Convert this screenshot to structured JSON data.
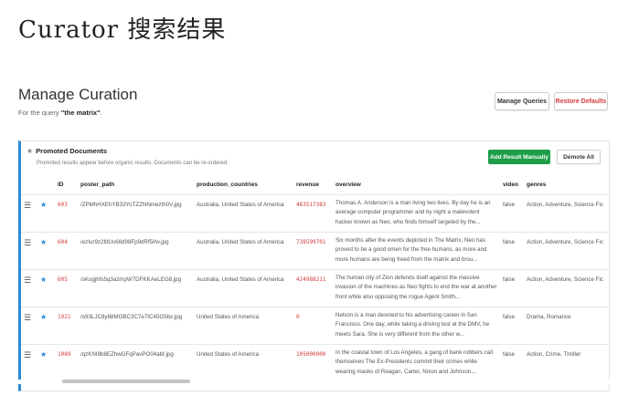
{
  "page_title": "Curator 搜索结果",
  "manage": {
    "title": "Manage Curation",
    "query_prefix": "For the query ",
    "query_text": "\"the matrix\"",
    "query_suffix": ".",
    "manage_queries_label": "Manage Queries",
    "restore_defaults_label": "Restore Defaults"
  },
  "promoted": {
    "title": "Promoted Documents",
    "subtitle": "Promoted results appear before organic results. Documents can be re-ordered.",
    "add_label": "Add Result Manually",
    "demote_label": "Demote All"
  },
  "table": {
    "columns": [
      "ID",
      "poster_path",
      "production_countries",
      "revenue",
      "overview",
      "video",
      "genres"
    ],
    "rows": [
      {
        "id": "603",
        "poster_path": "/ZPMhHXEhYB33YoTZZNNmezth0V.jpg",
        "production_countries": "Australia, United States of America",
        "revenue": "463517383",
        "overview": "Thomas A. Anderson is a man living two lives. By day he is an average computer programmer and by night a malevolent hacker known as Neo, who finds himself targeted by the...",
        "video": "false",
        "genres": "Action, Adventure, Science Fic"
      },
      {
        "id": "604",
        "poster_path": "/ezIur9z2fdUc68d98Fp9dRf5ihv.jpg",
        "production_countries": "Australia, United States of America",
        "revenue": "738599701",
        "overview": "Six months after the events depicted in The Matrix, Neo has proved to be a good omen for the free humans, as more and more humans are being freed from the matrix and brou...",
        "video": "false",
        "genres": "Action, Adventure, Science Fic"
      },
      {
        "id": "605",
        "poster_path": "/sKogjhfs5q3azmpW7DFKKAeLEG8.jpg",
        "production_countries": "Australia, United States of America",
        "revenue": "424988211",
        "overview": "The human city of Zion defends itself against the massive invasion of the machines as Neo fights to end the war at another front while also opposing the rogue Agent Smith...",
        "video": "false",
        "genres": "Action, Adventure, Science Fic"
      },
      {
        "id": "1921",
        "poster_path": "/o93LJC8y88MGBC3C7e7IC45G5bx.jpg",
        "production_countries": "United States of America",
        "revenue": "0",
        "overview": "Nelson is a man devoted to his advertising career in San Francisco. One day, while taking a driving test at the DMV, he meets Sara. She is very different from the other w...",
        "video": "false",
        "genres": "Drama, Romance"
      },
      {
        "id": "1089",
        "poster_path": "/qzKNI8b8EZhwGFqPavPO04abf.jpg",
        "production_countries": "United States of America",
        "revenue": "105000000",
        "overview": "In the coastal town of Los Angeles, a gang of bank robbers call themselves The Ex-Presidents commit their crimes while wearing masks of Reagan, Carter, Nixon and Johnson....",
        "video": "false",
        "genres": "Action, Crime, Thriller"
      }
    ]
  },
  "icons": {
    "drag": "drag-handle-icon",
    "promoted_star": "star-icon"
  },
  "colors": {
    "accent": "#2b8bd8",
    "success": "#1e9e4a",
    "danger": "#d33a3a"
  }
}
